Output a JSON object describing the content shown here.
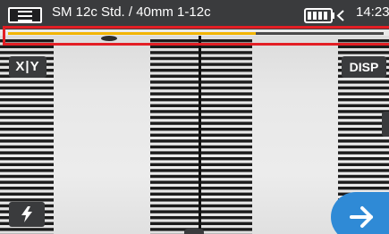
{
  "header": {
    "title": "SM 12c Std. / 40mm 1-12c",
    "time": "14:23",
    "menu_icon": "hamburger-menu-icon",
    "battery_icon": "battery-charging-icon"
  },
  "progress": {
    "fraction": 0.66,
    "color": "#f2b400"
  },
  "buttons": {
    "xy_label": "X|Y",
    "disp_label": "DISP",
    "arc_icon": "lightning-icon",
    "next_icon": "arrow-right-icon"
  },
  "colors": {
    "topbar": "#3a3b3d",
    "accent_blue": "#2f8ad6",
    "highlight_red": "#e31e24",
    "progress_yellow": "#f2b400"
  }
}
